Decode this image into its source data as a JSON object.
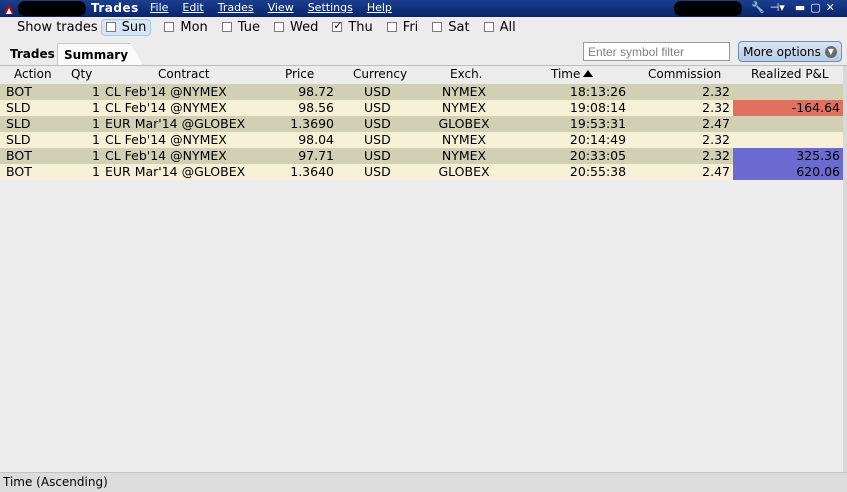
{
  "window": {
    "title": "Trades",
    "menu": [
      "File",
      "Edit",
      "Trades",
      "View",
      "Settings",
      "Help"
    ],
    "controls": [
      "wrench-icon",
      "pin-icon",
      "minimize-icon",
      "maximize-icon",
      "close-icon"
    ]
  },
  "show_trades": {
    "label": "Show trades",
    "days": [
      {
        "label": "Sun",
        "checked": false,
        "focused": true
      },
      {
        "label": "Mon",
        "checked": false
      },
      {
        "label": "Tue",
        "checked": false
      },
      {
        "label": "Wed",
        "checked": false
      },
      {
        "label": "Thu",
        "checked": true
      },
      {
        "label": "Fri",
        "checked": false
      },
      {
        "label": "Sat",
        "checked": false
      },
      {
        "label": "All",
        "checked": false
      }
    ]
  },
  "tabs": [
    {
      "label": "Trades",
      "active": false
    },
    {
      "label": "Summary",
      "active": true
    }
  ],
  "filter": {
    "placeholder": "Enter symbol filter"
  },
  "more_options": {
    "label": "More options"
  },
  "table": {
    "columns": [
      "Action",
      "Qty",
      "Contract",
      "Price",
      "Currency",
      "Exch.",
      "Time",
      "Commission",
      "Realized P&L"
    ],
    "sort_column": "Time",
    "rows": [
      {
        "action": "BOT",
        "qty": "1",
        "contract": "CL Feb'14 @NYMEX",
        "price": "98.72",
        "currency": "USD",
        "exch": "NYMEX",
        "time": "18:13:26",
        "commission": "2.32",
        "pnl": "",
        "pnl_color": ""
      },
      {
        "action": "SLD",
        "qty": "1",
        "contract": "CL Feb'14 @NYMEX",
        "price": "98.56",
        "currency": "USD",
        "exch": "NYMEX",
        "time": "19:08:14",
        "commission": "2.32",
        "pnl": "-164.64",
        "pnl_color": "#e07060"
      },
      {
        "action": "SLD",
        "qty": "1",
        "contract": "EUR Mar'14 @GLOBEX",
        "price": "1.3690",
        "currency": "USD",
        "exch": "GLOBEX",
        "time": "19:53:31",
        "commission": "2.47",
        "pnl": "",
        "pnl_color": ""
      },
      {
        "action": "SLD",
        "qty": "1",
        "contract": "CL Feb'14 @NYMEX",
        "price": "98.04",
        "currency": "USD",
        "exch": "NYMEX",
        "time": "20:14:49",
        "commission": "2.32",
        "pnl": "",
        "pnl_color": ""
      },
      {
        "action": "BOT",
        "qty": "1",
        "contract": "CL Feb'14 @NYMEX",
        "price": "97.71",
        "currency": "USD",
        "exch": "NYMEX",
        "time": "20:33:05",
        "commission": "2.32",
        "pnl": "325.36",
        "pnl_color": "#6a6ad0"
      },
      {
        "action": "BOT",
        "qty": "1",
        "contract": "EUR Mar'14 @GLOBEX",
        "price": "1.3640",
        "currency": "USD",
        "exch": "GLOBEX",
        "time": "20:55:38",
        "commission": "2.47",
        "pnl": "620.06",
        "pnl_color": "#6a6ad0"
      }
    ]
  },
  "status": {
    "text": "Time (Ascending)"
  },
  "colors": {
    "row_a": "#d1cfb4",
    "row_b": "#f5f0d6",
    "title_bar": "#0a246a"
  }
}
